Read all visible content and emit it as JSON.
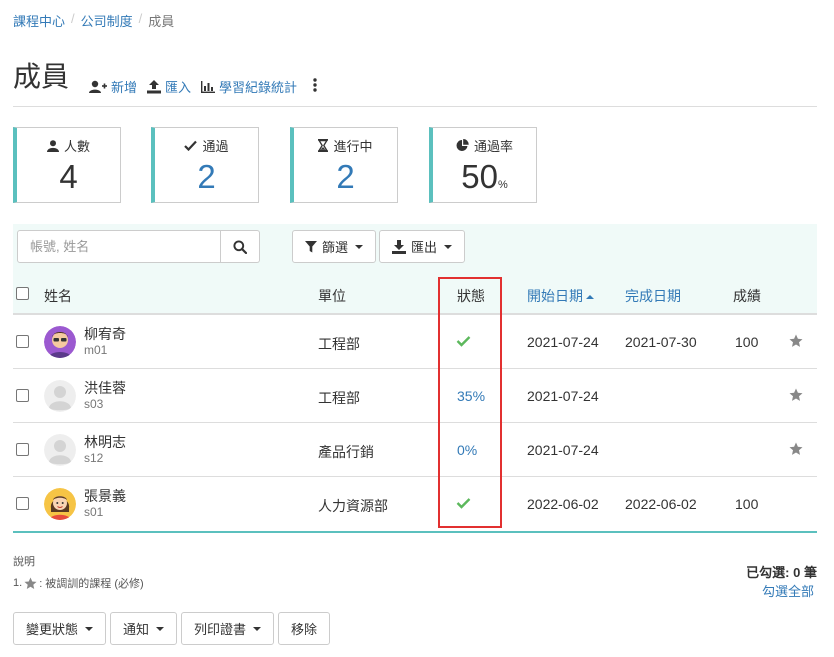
{
  "breadcrumb": {
    "items": [
      "課程中心",
      "公司制度",
      "成員"
    ],
    "separator": "/"
  },
  "header": {
    "title": "成員",
    "add_label": "新增",
    "import_label": "匯入",
    "stats_label": "學習紀錄統計"
  },
  "stats": [
    {
      "label": "人數",
      "value": "4",
      "icon": "user-icon"
    },
    {
      "label": "通過",
      "value": "2",
      "icon": "check-icon"
    },
    {
      "label": "進行中",
      "value": "2",
      "icon": "hourglass-icon"
    },
    {
      "label": "通過率",
      "value": "50",
      "unit": "%",
      "icon": "pie-chart-icon"
    }
  ],
  "filter": {
    "search_placeholder": "帳號, 姓名",
    "filter_label": "篩選",
    "export_label": "匯出"
  },
  "table": {
    "columns": {
      "name": "姓名",
      "unit": "單位",
      "status": "狀態",
      "start_date": "開始日期",
      "end_date": "完成日期",
      "score": "成績"
    },
    "rows": [
      {
        "name": "柳宥奇",
        "account": "m01",
        "unit": "工程部",
        "status": "passed",
        "status_text": "",
        "start": "2021-07-24",
        "end": "2021-07-30",
        "score": "100",
        "starred": true,
        "avatar": "purple"
      },
      {
        "name": "洪佳蓉",
        "account": "s03",
        "unit": "工程部",
        "status": "progress",
        "status_text": "35%",
        "start": "2021-07-24",
        "end": "",
        "score": "",
        "starred": true,
        "avatar": "gray"
      },
      {
        "name": "林明志",
        "account": "s12",
        "unit": "產品行銷",
        "status": "progress",
        "status_text": "0%",
        "start": "2021-07-24",
        "end": "",
        "score": "",
        "starred": true,
        "avatar": "gray"
      },
      {
        "name": "張景義",
        "account": "s01",
        "unit": "人力資源部",
        "status": "passed",
        "status_text": "",
        "start": "2022-06-02",
        "end": "2022-06-02",
        "score": "100",
        "starred": false,
        "avatar": "yellow"
      }
    ]
  },
  "notes": {
    "title": "說明",
    "item_prefix": "1.",
    "item_text": ": 被調訓的課程 (必修)"
  },
  "selection": {
    "label": "已勾選:",
    "count": "0",
    "unit": "筆",
    "select_all": "勾選全部"
  },
  "actions": {
    "change_status": "變更狀態",
    "notify": "通知",
    "print_cert": "列印證書",
    "remove": "移除"
  },
  "colors": {
    "accent": "#5bc0be",
    "link": "#337ab7",
    "check": "#5cb85c",
    "highlight": "#e23030",
    "star": "#888888"
  }
}
